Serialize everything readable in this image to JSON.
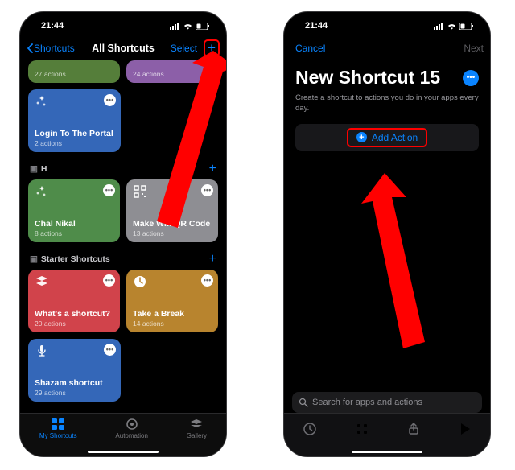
{
  "statusbar": {
    "time": "21:44"
  },
  "left": {
    "nav": {
      "back": "Shortcuts",
      "title": "All Shortcuts",
      "select": "Select"
    },
    "truncated": [
      {
        "sub": "27 actions",
        "color": "#557e3a"
      },
      {
        "sub": "24 actions",
        "color": "#8c5fa8"
      }
    ],
    "loose": {
      "title": "Login To The Portal",
      "sub": "2 actions",
      "color": "#3467b8"
    },
    "sections": [
      {
        "header": "H",
        "tiles": [
          {
            "title": "Chal Nikal",
            "sub": "8 actions",
            "color": "#4f8c4a",
            "icon": "wand"
          },
          {
            "title": "Make Wifi QR Code",
            "sub": "13 actions",
            "color": "#8e8e93",
            "icon": "qr"
          }
        ]
      },
      {
        "header": "Starter Shortcuts",
        "tiles": [
          {
            "title": "What's a shortcut?",
            "sub": "20 actions",
            "color": "#d1434b",
            "icon": "stack"
          },
          {
            "title": "Take a Break",
            "sub": "14 actions",
            "color": "#b8842e",
            "icon": "clock"
          }
        ]
      }
    ],
    "extra": {
      "title": "Shazam shortcut",
      "sub": "29 actions",
      "color": "#3467b8",
      "icon": "mic"
    },
    "tabs": {
      "shortcuts": "My Shortcuts",
      "automation": "Automation",
      "gallery": "Gallery"
    }
  },
  "right": {
    "nav": {
      "cancel": "Cancel",
      "next": "Next"
    },
    "title": "New Shortcut 15",
    "desc": "Create a shortcut to actions you do in your apps every day.",
    "addAction": "Add Action",
    "searchPlaceholder": "Search for apps and actions"
  }
}
